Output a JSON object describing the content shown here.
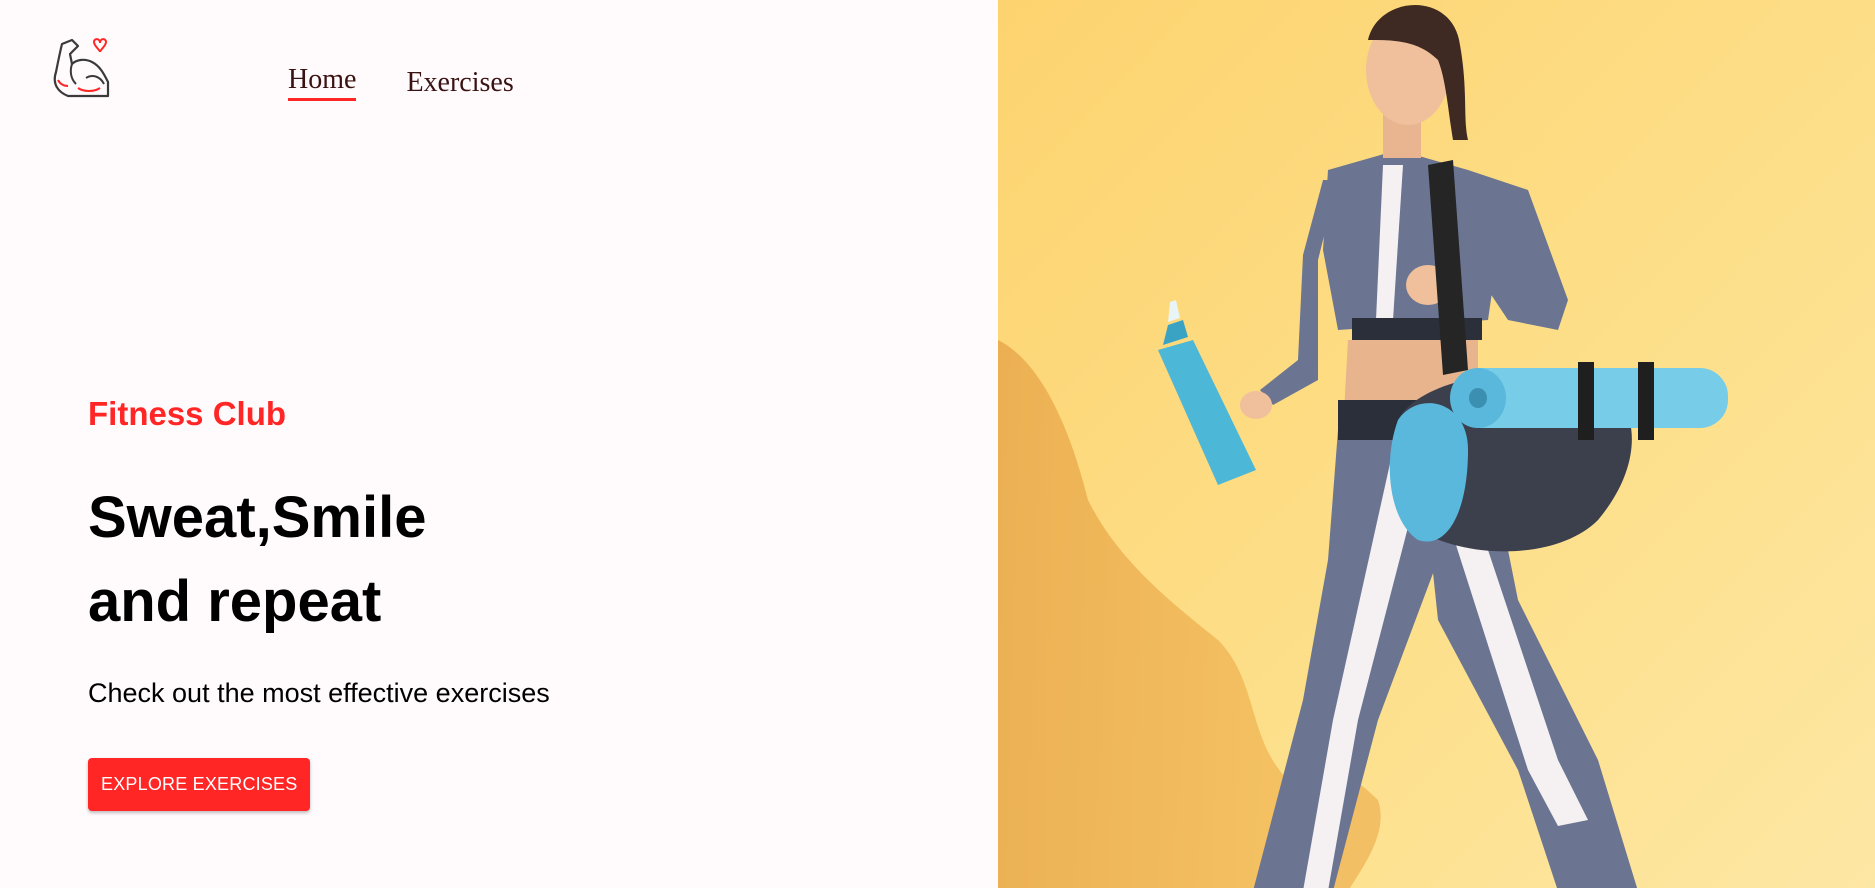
{
  "nav": {
    "items": [
      {
        "label": "Home",
        "active": true
      },
      {
        "label": "Exercises",
        "active": false
      }
    ]
  },
  "hero": {
    "tag": "Fitness Club",
    "title_line1": "Sweat,Smile",
    "title_line2": "and repeat",
    "subtitle": "Check out the most effective exercises",
    "cta_label": "EXPLORE EXERCISES"
  },
  "colors": {
    "accent": "#ff2625",
    "page_bg": "#fffafb",
    "photo_bg": "#fbd77a"
  },
  "icons": {
    "logo": "flexed-arm-heart-icon"
  }
}
